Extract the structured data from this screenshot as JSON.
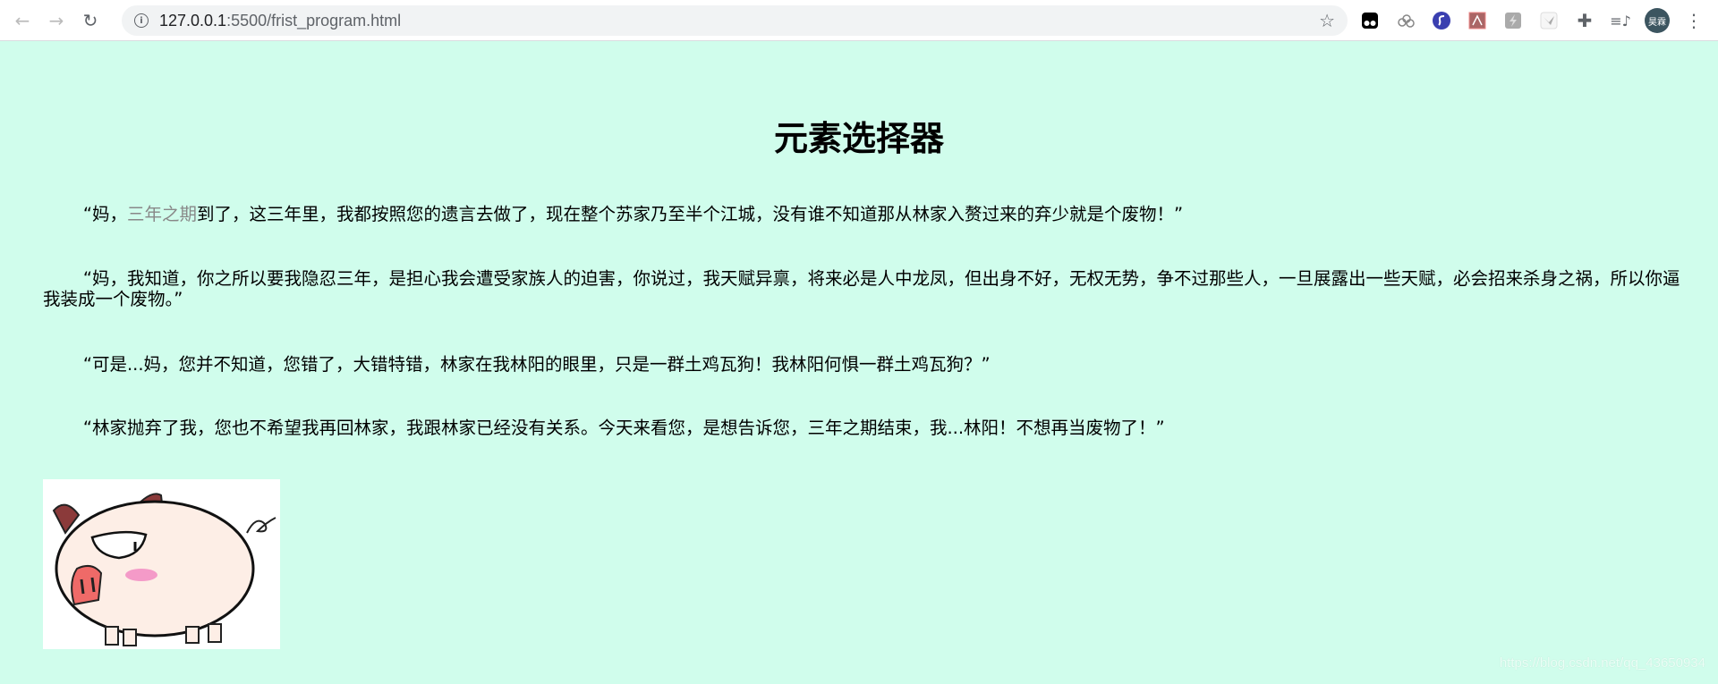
{
  "browser": {
    "url_host": "127.0.0.1",
    "url_rest": ":5500/frist_program.html",
    "avatar_text": "昊霖",
    "extensions": [
      "tampermonkey-icon",
      "cloud-sync-icon",
      "s-extension-icon",
      "pdf-icon",
      "lightning-icon",
      "bird-icon",
      "puzzle-icon",
      "media-queue-icon"
    ]
  },
  "page": {
    "title": "元素选择器",
    "paragraphs": [
      {
        "pre": "“妈，",
        "highlight": "三年之期",
        "post": "到了，这三年里，我都按照您的遗言去做了，现在整个苏家乃至半个江城，没有谁不知道那从林家入赘过来的弃少就是个废物！”"
      },
      {
        "text": "“妈，我知道，你之所以要我隐忍三年，是担心我会遭受家族人的迫害，你说过，我天赋异禀，将来必是人中龙凤，但出身不好，无权无势，争不过那些人，一旦展露出一些天赋，必会招来杀身之祸，所以你逼我装成一个废物。”"
      },
      {
        "text": "“可是...妈，您并不知道，您错了，大错特错，林家在我林阳的眼里，只是一群土鸡瓦狗！我林阳何惧一群土鸡瓦狗？”"
      },
      {
        "text": "“林家抛弃了我，您也不希望我再回林家，我跟林家已经没有关系。今天来看您，是想告诉您，三年之期结束，我...林阳！不想再当废物了！”"
      }
    ],
    "highlight_color": "#888888",
    "background": "#d0fdec"
  },
  "watermark": "https://blog.csdn.net/qq_43650934"
}
